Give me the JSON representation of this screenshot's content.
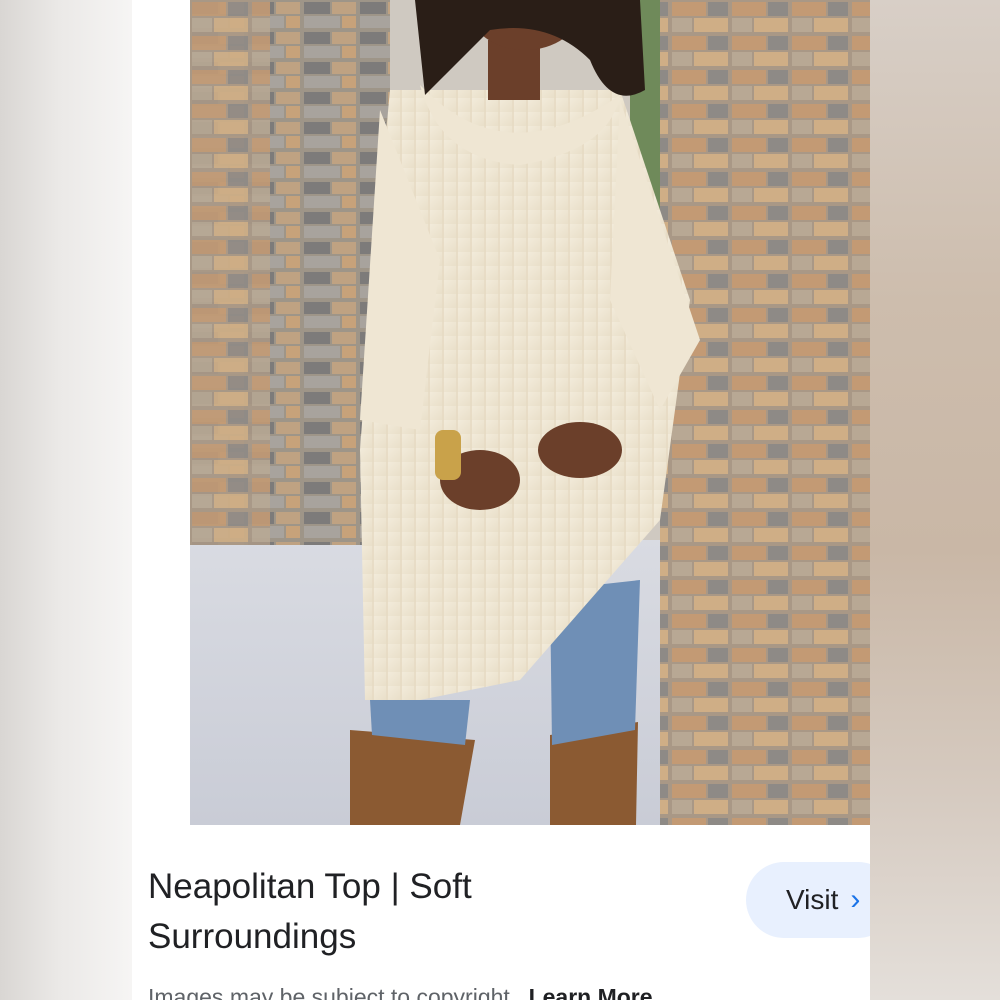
{
  "result": {
    "title_line1": "Neapolitan Top | Soft",
    "title_line2": "Surroundings",
    "visit_label": "Visit",
    "visit_icon": "chevron-right-icon",
    "copyright_notice": "Images may be subject to copyright.",
    "learn_more_label": "Learn More"
  },
  "colors": {
    "visit_button_bg": "#e8f0fe",
    "accent": "#1a73e8",
    "title_text": "#202124"
  }
}
